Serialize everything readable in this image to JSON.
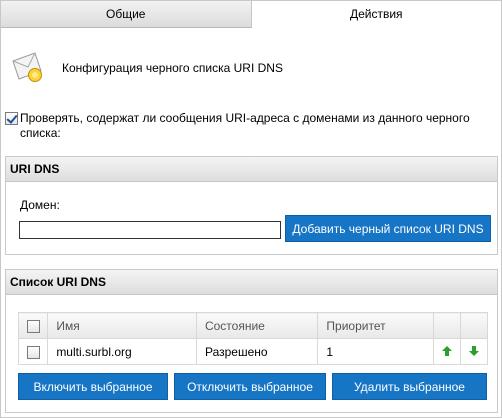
{
  "tabs": [
    {
      "label": "Общие",
      "active": false
    },
    {
      "label": "Действия",
      "active": true
    }
  ],
  "header": {
    "title": "Конфигурация черного списка URI DNS",
    "icon": "mail-icon"
  },
  "check_option": {
    "checked": true,
    "label": "Проверять, содержат ли сообщения URI-адреса с доменами из данного черного списка:"
  },
  "uri_dns_group": {
    "title": "URI DNS",
    "domain_label": "Домен:",
    "domain_value": "",
    "add_button": "Добавить черный список URI DNS"
  },
  "list_group": {
    "title": "Список URI DNS",
    "columns": [
      "Имя",
      "Состояние",
      "Приоритет"
    ],
    "rows": [
      {
        "checked": false,
        "name": "multi.surbl.org",
        "state": "Разрешено",
        "priority": "1"
      }
    ],
    "buttons": {
      "enable": "Включить выбранное",
      "disable": "Отключить выбранное",
      "delete": "Удалить выбранное"
    }
  },
  "colors": {
    "button": "#1775c5",
    "arrow": "#2e9e2e"
  }
}
